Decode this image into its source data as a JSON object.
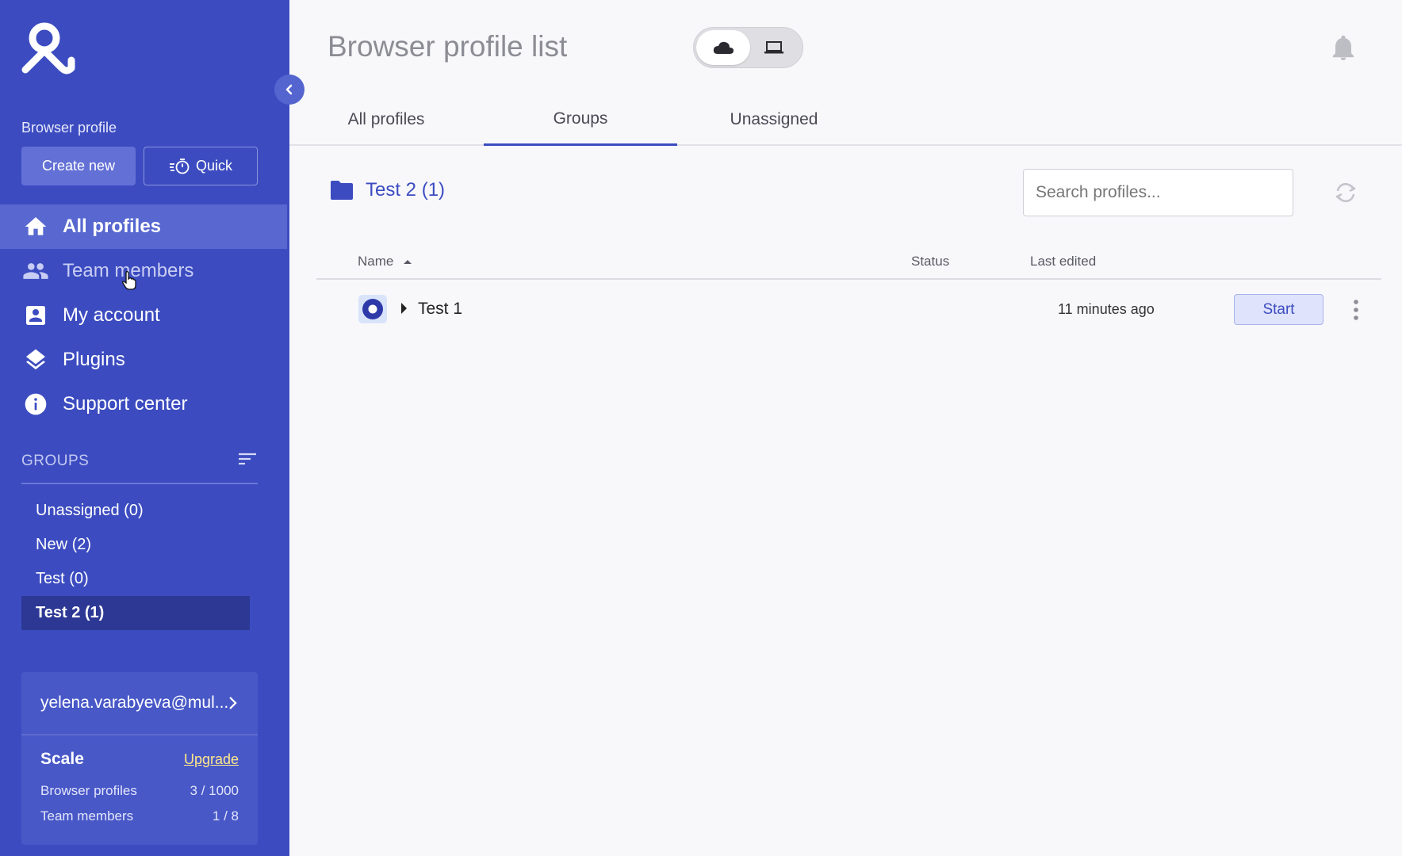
{
  "sidebar": {
    "section_label": "Browser profile",
    "create_new": "Create new",
    "quick": "Quick",
    "nav": [
      {
        "label": "All profiles",
        "icon": "home-icon"
      },
      {
        "label": "Team members",
        "icon": "people-icon"
      },
      {
        "label": "My account",
        "icon": "account-box-icon"
      },
      {
        "label": "Plugins",
        "icon": "layers-icon"
      },
      {
        "label": "Support center",
        "icon": "info-icon"
      }
    ],
    "groups_label": "GROUPS",
    "groups": [
      {
        "label": "Unassigned  (0)"
      },
      {
        "label": "New  (2)"
      },
      {
        "label": "Test  (0)"
      },
      {
        "label": "Test 2  (1)"
      }
    ],
    "account": {
      "email": "yelena.varabyeva@mul...",
      "plan": "Scale",
      "upgrade": "Upgrade",
      "stats": [
        {
          "label": "Browser profiles",
          "value": "3 / 1000"
        },
        {
          "label": "Team members",
          "value": "1 / 8"
        }
      ]
    }
  },
  "header": {
    "title": "Browser profile list"
  },
  "tabs": [
    {
      "label": "All profiles"
    },
    {
      "label": "Groups"
    },
    {
      "label": "Unassigned"
    }
  ],
  "group_view": {
    "title": "Test 2 (1)",
    "search_placeholder": "Search profiles..."
  },
  "table": {
    "columns": {
      "name": "Name",
      "status": "Status",
      "last_edited": "Last edited"
    },
    "rows": [
      {
        "name": "Test 1",
        "status": "",
        "last_edited": "11 minutes ago",
        "action": "Start"
      }
    ]
  },
  "colors": {
    "sidebar_bg": "#3c4cc0",
    "accent": "#3c4cc0",
    "upgrade": "#ffe88a"
  }
}
